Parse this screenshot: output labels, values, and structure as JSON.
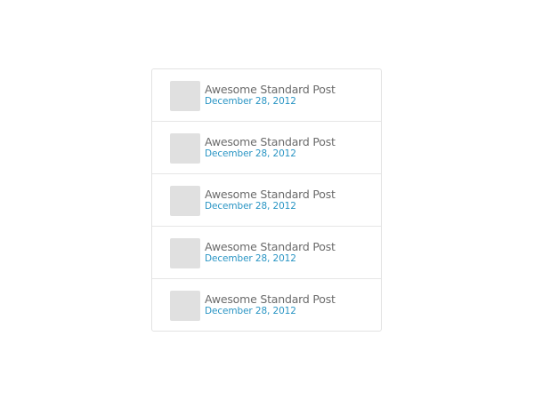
{
  "posts": [
    {
      "title": "Awesome Standard Post",
      "date": "December 28, 2012"
    },
    {
      "title": "Awesome Standard Post",
      "date": "December 28, 2012"
    },
    {
      "title": "Awesome Standard Post",
      "date": "December 28, 2012"
    },
    {
      "title": "Awesome Standard Post",
      "date": "December 28, 2012"
    },
    {
      "title": "Awesome Standard Post",
      "date": "December 28, 2012"
    }
  ],
  "colors": {
    "title": "#6b6b6b",
    "date": "#2a95c4",
    "thumbnail": "#e0e0e0",
    "border": "#e2e2e2"
  }
}
